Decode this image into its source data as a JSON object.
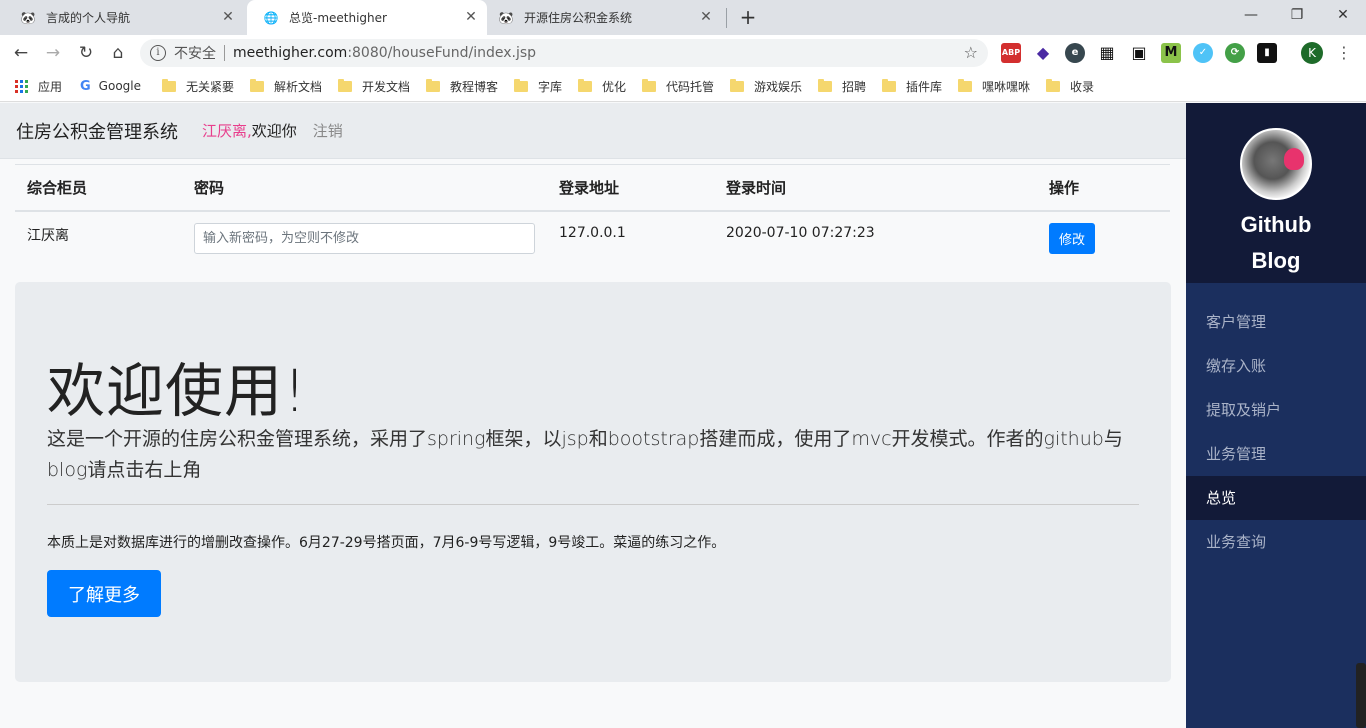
{
  "browser": {
    "tabs": [
      {
        "title": "言成的个人导航",
        "active": false
      },
      {
        "title": "总览-meethigher",
        "active": true
      },
      {
        "title": "开源住房公积金系统",
        "active": false
      }
    ],
    "address": {
      "security_label": "不安全",
      "host": "meethigher.com",
      "path": ":8080/houseFund/index.jsp"
    },
    "extensions": [
      "ABP",
      "◆",
      "e",
      "▦",
      "▣",
      "M",
      "✓",
      "⟳",
      "▮"
    ],
    "profile_initial": "K",
    "bookmarks": [
      "应用",
      "Google",
      "无关紧要",
      "解析文档",
      "开发文档",
      "教程博客",
      "字库",
      "优化",
      "代码托管",
      "游戏娱乐",
      "招聘",
      "插件库",
      "嘿咻嘿咻",
      "收录"
    ]
  },
  "header": {
    "system_title": "住房公积金管理系统",
    "user_name": "江厌离,",
    "welcome": "欢迎你",
    "logout": "注销"
  },
  "admin_table": {
    "columns": [
      "综合柜员",
      "密码",
      "登录地址",
      "登录时间",
      "操作"
    ],
    "row": {
      "teller": "江厌离",
      "password_placeholder": "输入新密码，为空则不修改",
      "login_address": "127.0.0.1",
      "login_time": "2020-07-10 07:27:23",
      "action_label": "修改"
    }
  },
  "jumbotron": {
    "title": "欢迎使用!",
    "lead": "这是一个开源的住房公积金管理系统，采用了spring框架，以jsp和bootstrap搭建而成，使用了mvc开发模式。作者的github与blog请点击右上角",
    "note": "本质上是对数据库进行的增删改查操作。6月27-29号搭页面，7月6-9号写逻辑，9号竣工。菜逼的练习之作。",
    "button_label": "了解更多"
  },
  "sidebar": {
    "title_line1": "Github",
    "title_line2": "Blog",
    "items": [
      {
        "label": "客户管理",
        "active": false
      },
      {
        "label": "缴存入账",
        "active": false
      },
      {
        "label": "提取及销户",
        "active": false
      },
      {
        "label": "业务管理",
        "active": false
      },
      {
        "label": "总览",
        "active": true
      },
      {
        "label": "业务查询",
        "active": false
      }
    ]
  },
  "colors": {
    "primary": "#007bff",
    "sidebar_bg": "#1b2f5e",
    "sidebar_head_bg": "#121a38",
    "user_name": "#e83e8c"
  }
}
